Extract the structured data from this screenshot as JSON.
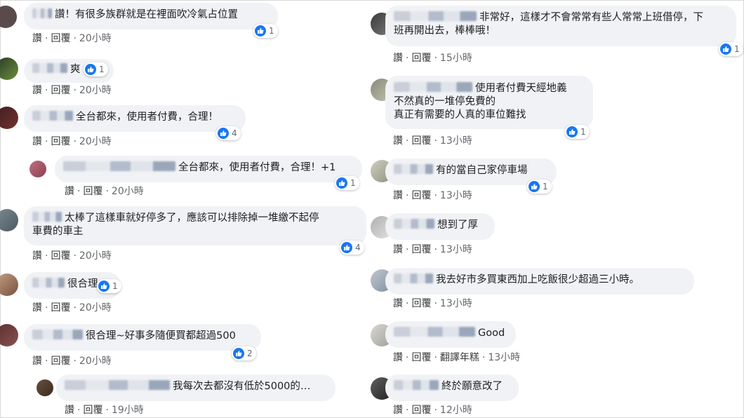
{
  "labels": {
    "like": "讚",
    "reply": "回覆",
    "translate": "翻譯年糕",
    "dot": "·"
  },
  "left": [
    {
      "text": [
        "讚！有很多族群就是在裡面吹冷氣占位置"
      ],
      "likes": "1",
      "time": "20小時"
    },
    {
      "text": [
        "爽"
      ],
      "likes": "1",
      "time": "20小時"
    },
    {
      "text": [
        "全台都來，使用者付費，合理！"
      ],
      "likes": "4",
      "time": "20小時"
    },
    {
      "text": [
        "全台都來，使用者付費，合理！+1"
      ],
      "likes": "1",
      "time": "20小時"
    },
    {
      "text": [
        "太棒了這樣車就好停多了，應該可以排除掉一堆繳不起停",
        "車費的車主"
      ],
      "likes": "4",
      "time": "20小時"
    },
    {
      "text": [
        "很合理"
      ],
      "likes": "1",
      "time": "20小時"
    },
    {
      "text": [
        "很合理~好事多隨便買都超過500"
      ],
      "likes": "2",
      "time": "20小時"
    },
    {
      "text": [
        "我每次去都沒有低於5000的…"
      ],
      "likes": "",
      "time": "19小時"
    }
  ],
  "right": [
    {
      "text": [
        "非常好，這樣才不會常常有些人常常上班借停，下",
        "班再開出去，棒棒哦！"
      ],
      "likes": "1",
      "time": "15小時"
    },
    {
      "text": [
        "使用者付費天經地義",
        "不然真的一堆停免費的",
        "真正有需要的人真的車位難找"
      ],
      "likes": "1",
      "time": "13小時"
    },
    {
      "text": [
        "有的當自己家停車場"
      ],
      "likes": "1",
      "time": "13小時"
    },
    {
      "text": [
        "想到了厚"
      ],
      "likes": "",
      "time": "13小時"
    },
    {
      "text": [
        "我去好市多買東西加上吃飯很少超過三小時。"
      ],
      "likes": "",
      "time": "13小時"
    },
    {
      "text": [
        "Good"
      ],
      "likes": "",
      "time": "13小時"
    },
    {
      "text": [
        "終於願意改了"
      ],
      "likes": "",
      "time": "12小時"
    }
  ],
  "colors": {
    "like": "#1877f2",
    "bubble": "#f0f2f5"
  }
}
